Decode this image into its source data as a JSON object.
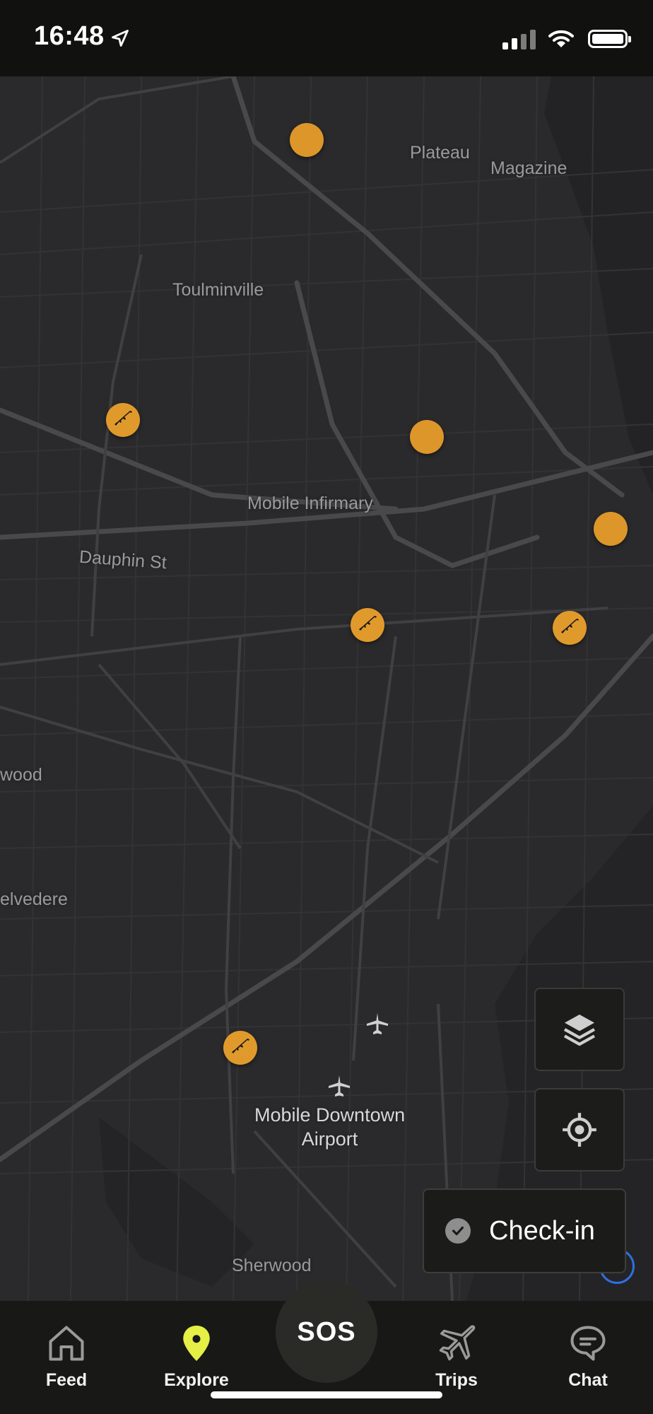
{
  "status_bar": {
    "time": "16:48",
    "location_icon": "location-arrow-icon",
    "signal_icon": "signal-icon",
    "wifi_icon": "wifi-icon",
    "battery_icon": "battery-icon"
  },
  "map": {
    "labels": {
      "plateau": "Plateau",
      "magazine": "Magazine",
      "toulminville": "Toulminville",
      "mobile_infirmary": "Mobile Infirmary",
      "dauphin_st": "Dauphin St",
      "wood": "wood",
      "belvedere": "elvedere",
      "airport": "Mobile Downtown\nAirport",
      "sherwood": "Sherwood"
    },
    "marker_color": "#e09a2c",
    "markers": [
      {
        "type": "plain"
      },
      {
        "type": "weapon",
        "icon": "rifle-icon"
      },
      {
        "type": "plain"
      },
      {
        "type": "plain"
      },
      {
        "type": "weapon",
        "icon": "rifle-icon"
      },
      {
        "type": "weapon",
        "icon": "rifle-icon"
      },
      {
        "type": "weapon",
        "icon": "rifle-icon"
      }
    ]
  },
  "controls": {
    "layers_icon": "layers-icon",
    "locate_icon": "crosshair-icon",
    "checkin_label": "Check-in",
    "checkin_icon": "check-circle-icon"
  },
  "nav": {
    "feed": {
      "label": "Feed",
      "icon": "home-icon"
    },
    "explore": {
      "label": "Explore",
      "icon": "map-pin-icon",
      "active_color": "#e5ef46"
    },
    "sos": {
      "label": "SOS"
    },
    "trips": {
      "label": "Trips",
      "icon": "airplane-icon"
    },
    "chat": {
      "label": "Chat",
      "icon": "chat-bubble-icon"
    }
  }
}
